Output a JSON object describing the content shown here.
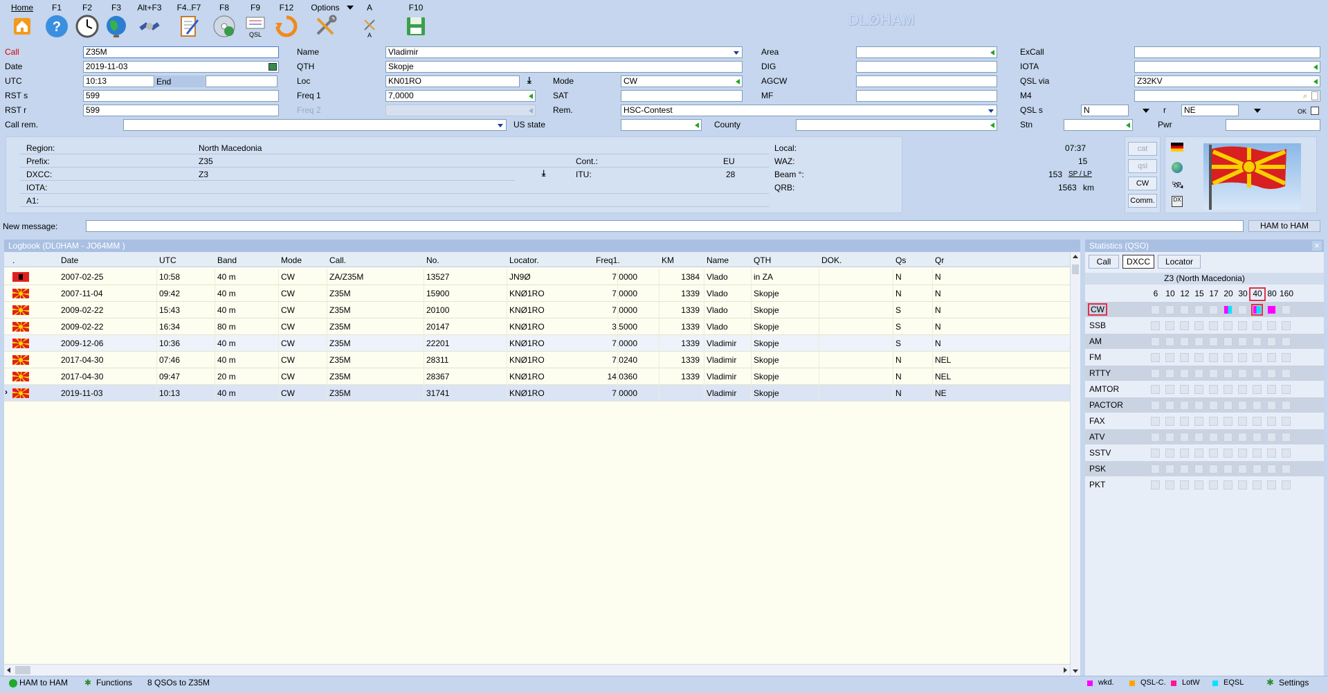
{
  "app": {
    "title": "DLØHAM"
  },
  "toolbar": [
    {
      "key": "Home",
      "icon": "home-icon"
    },
    {
      "key": "F1",
      "icon": "help-icon"
    },
    {
      "key": "F2",
      "icon": "clock-icon"
    },
    {
      "key": "F3",
      "icon": "globe-icon"
    },
    {
      "key": "Alt+F3",
      "icon": "satellite-icon"
    },
    {
      "key": "F4..F7",
      "icon": "notepad-icon"
    },
    {
      "key": "F8",
      "icon": "cd-icon"
    },
    {
      "key": "F9",
      "icon": "qsl-card-icon",
      "sub": "QSL"
    },
    {
      "key": "F12",
      "icon": "refresh-icon"
    },
    {
      "key": "Options",
      "icon": "tools-icon"
    },
    {
      "key": "A",
      "icon": "font-tools-icon",
      "sub": "A"
    },
    {
      "key": "F10",
      "icon": "save-icon"
    }
  ],
  "form": {
    "call_label": "Call",
    "call": "Z35M",
    "date_label": "Date",
    "date": "2019-11-03",
    "utc_label": "UTC",
    "utc": "10:13",
    "end_label": "End",
    "end": "",
    "rsts_label": "RST s",
    "rsts": "599",
    "rstr_label": "RST r",
    "rstr": "599",
    "callrem_label": "Call rem.",
    "callrem": "",
    "name_label": "Name",
    "name": "Vladimir",
    "qth_label": "QTH",
    "qth": "Skopje",
    "loc_label": "Loc",
    "loc": "KN01RO",
    "freq1_label": "Freq 1",
    "freq1": "7,0000",
    "freq2_label": "Freq 2",
    "freq2": "",
    "usstate_label": "US state",
    "usstate": "",
    "mode_label": "Mode",
    "mode": "CW",
    "sat_label": "SAT",
    "sat": "",
    "rem_label": "Rem.",
    "rem": "HSC-Contest",
    "county_label": "County",
    "county": "",
    "area_label": "Area",
    "area": "",
    "dig_label": "DIG",
    "dig": "",
    "agcw_label": "AGCW",
    "agcw": "",
    "mf_label": "MF",
    "mf": "",
    "excall_label": "ExCall",
    "excall": "",
    "iota_label": "IOTA",
    "iota": "",
    "qslvia_label": "QSL via",
    "qslvia": "Z32KV",
    "m4_label": "M4",
    "m4": "",
    "qsls_label": "QSL s",
    "qsls": "N",
    "r_label": "r",
    "r": "NE",
    "ok_label": "OK",
    "stn_label": "Stn",
    "stn": "",
    "pwr_label": "Pwr",
    "pwr": ""
  },
  "info": {
    "region_label": "Region:",
    "region": "North Macedonia",
    "prefix_label": "Prefix:",
    "prefix": "Z35",
    "dxcc_label": "DXCC:",
    "dxcc": "Z3",
    "iota_label": "IOTA:",
    "iota": "",
    "a1_label": "A1:",
    "a1": "",
    "cont_label": "Cont.:",
    "cont": "EU",
    "itu_label": "ITU:",
    "itu": "28",
    "local_label": "Local:",
    "local": "07:37",
    "waz_label": "WAZ:",
    "waz": "15",
    "beam_label": "Beam °:",
    "beam": "153",
    "splp": "SP / LP",
    "qrb_label": "QRB:",
    "qrb": "1563",
    "km": "km",
    "side_buttons": [
      "cat",
      "qsl",
      "CW",
      "Comm."
    ]
  },
  "message": {
    "label": "New message:",
    "value": "",
    "button": "HAM to HAM"
  },
  "logbook": {
    "title": "Logbook  (DL0HAM - JO64MM )",
    "columns": [
      ".",
      "Date",
      "UTC",
      "Band",
      "Mode",
      "Call.",
      "No.",
      "Locator.",
      "Freq1.",
      "KM",
      "Name",
      "QTH",
      "DOK.",
      "Qs",
      "Qr"
    ],
    "rows": [
      {
        "flag": "albania",
        "date": "2007-02-25",
        "utc": "10:58",
        "band": "40 m",
        "mode": "CW",
        "call": "ZA/Z35M",
        "no": "13527",
        "loc": "JN9Ø",
        "freq": "7,0000",
        "km": "1384",
        "name": "Vlado",
        "qth": "in ZA",
        "dok": "",
        "qs": "N",
        "qr": "N"
      },
      {
        "flag": "macedonia",
        "date": "2007-11-04",
        "utc": "09:42",
        "band": "40 m",
        "mode": "CW",
        "call": "Z35M",
        "no": "15900",
        "loc": "KNØ1RO",
        "freq": "7,0000",
        "km": "1339",
        "name": "Vlado",
        "qth": "Skopje",
        "dok": "",
        "qs": "N",
        "qr": "N"
      },
      {
        "flag": "macedonia",
        "date": "2009-02-22",
        "utc": "15:43",
        "band": "40 m",
        "mode": "CW",
        "call": "Z35M",
        "no": "20100",
        "loc": "KNØ1RO",
        "freq": "7,0000",
        "km": "1339",
        "name": "Vlado",
        "qth": "Skopje",
        "dok": "",
        "qs": "S",
        "qr": "N"
      },
      {
        "flag": "macedonia",
        "date": "2009-02-22",
        "utc": "16:34",
        "band": "80 m",
        "mode": "CW",
        "call": "Z35M",
        "no": "20147",
        "loc": "KNØ1RO",
        "freq": "3,5000",
        "km": "1339",
        "name": "Vlado",
        "qth": "Skopje",
        "dok": "",
        "qs": "S",
        "qr": "N"
      },
      {
        "flag": "macedonia",
        "date": "2009-12-06",
        "utc": "10:36",
        "band": "40 m",
        "mode": "CW",
        "call": "Z35M",
        "no": "22201",
        "loc": "KNØ1RO",
        "freq": "7,0000",
        "km": "1339",
        "name": "Vladimir",
        "qth": "Skopje",
        "dok": "",
        "qs": "S",
        "qr": "N"
      },
      {
        "flag": "macedonia",
        "date": "2017-04-30",
        "utc": "07:46",
        "band": "40 m",
        "mode": "CW",
        "call": "Z35M",
        "no": "28311",
        "loc": "KNØ1RO",
        "freq": "7,0240",
        "km": "1339",
        "name": "Vladimir",
        "qth": "Skopje",
        "dok": "",
        "qs": "N",
        "qr": "NEL"
      },
      {
        "flag": "macedonia",
        "date": "2017-04-30",
        "utc": "09:47",
        "band": "20 m",
        "mode": "CW",
        "call": "Z35M",
        "no": "28367",
        "loc": "KNØ1RO",
        "freq": "14,0360",
        "km": "1339",
        "name": "Vladimir",
        "qth": "Skopje",
        "dok": "",
        "qs": "N",
        "qr": "NEL"
      },
      {
        "flag": "macedonia",
        "date": "2019-11-03",
        "utc": "10:13",
        "band": "40 m",
        "mode": "CW",
        "call": "Z35M",
        "no": "31741",
        "loc": "KNØ1RO",
        "freq": "7,0000",
        "km": "",
        "name": "Vladimir",
        "qth": "Skopje",
        "dok": "",
        "qs": "N",
        "qr": "NE"
      }
    ]
  },
  "stats": {
    "title": "Statistics (QSO)",
    "tabs": [
      "Call",
      "DXCC",
      "Locator"
    ],
    "heading": "Z3 (North Macedonia)",
    "bands": [
      "6",
      "10",
      "12",
      "15",
      "17",
      "20",
      "30",
      "40",
      "80",
      "160"
    ],
    "modes": [
      "CW",
      "SSB",
      "AM",
      "FM",
      "RTTY",
      "AMTOR",
      "PACTOR",
      "FAX",
      "ATV",
      "SSTV",
      "PSK",
      "PKT"
    ],
    "legend": [
      {
        "label": "wkd.",
        "color": "#ff00ff"
      },
      {
        "label": "QSL-C.",
        "color": "#ffa500"
      },
      {
        "label": "LotW",
        "color": "#ff1493"
      },
      {
        "label": "EQSL",
        "color": "#00e5ff"
      }
    ],
    "settings": "Settings"
  },
  "status": {
    "ham": "HAM to HAM",
    "functions": "Functions",
    "count": "8 QSOs to Z35M"
  }
}
